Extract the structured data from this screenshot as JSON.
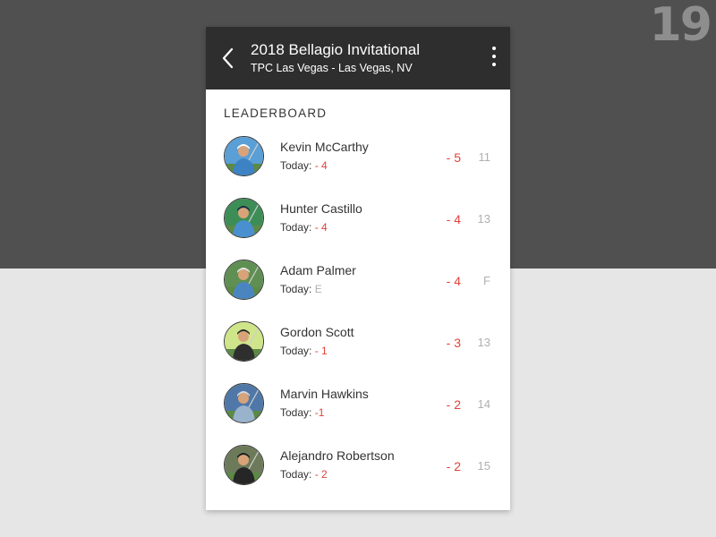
{
  "corner_number": "19",
  "header": {
    "title": "2018 Bellagio Invitational",
    "subtitle": "TPC Las Vegas - Las Vegas, NV"
  },
  "section_label": "LEADERBOARD",
  "today_prefix": "Today:",
  "colors": {
    "under_par": "#e2413b",
    "muted": "#b0b0b0",
    "appbar": "#2e2e2e",
    "background_top": "#505050",
    "background_bottom": "#e6e6e6"
  },
  "players": [
    {
      "name": "Kevin McCarthy",
      "today": "- 4",
      "score": "- 5",
      "thru": "11",
      "photo": "golfer-photo",
      "sky": "#5a9fd6",
      "shirt": "#3d82c4",
      "hat": "#ffffff"
    },
    {
      "name": "Hunter Castillo",
      "today": "- 4",
      "score": "- 4",
      "thru": "13",
      "photo": "golfer-photo",
      "sky": "#3d8e56",
      "shirt": "#4a8fd0",
      "hat": "#1e2a44"
    },
    {
      "name": "Adam Palmer",
      "today": "E",
      "score": "- 4",
      "thru": "F",
      "photo": "golfer-photo",
      "sky": "#5f8f52",
      "shirt": "#4b85c0",
      "hat": "#e8e8e8"
    },
    {
      "name": "Gordon Scott",
      "today": "- 1",
      "score": "- 3",
      "thru": "13",
      "photo": "golfer-photo",
      "sky": "#cfe58a",
      "shirt": "#2f2f2f",
      "hat": "#2a2a2a"
    },
    {
      "name": "Marvin Hawkins",
      "today": "-1",
      "score": "- 2",
      "thru": "14",
      "photo": "golfer-photo",
      "sky": "#4f78a8",
      "shirt": "#9ab3cc",
      "hat": "#d8d8d8"
    },
    {
      "name": "Alejandro Robertson",
      "today": "- 2",
      "score": "- 2",
      "thru": "15",
      "photo": "golfer-photo",
      "sky": "#6c7a5a",
      "shirt": "#262626",
      "hat": "#1c1c1c"
    }
  ]
}
